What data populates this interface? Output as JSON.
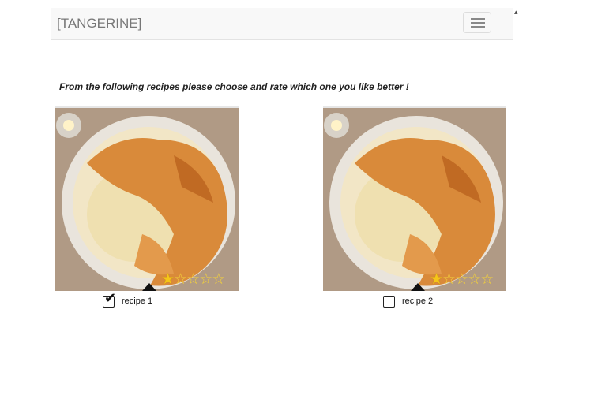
{
  "navbar": {
    "brand": "[TANGERINE]",
    "menu_icon": "hamburger-menu-icon"
  },
  "instruction": "From the following recipes please choose and rate which one you like better !",
  "recipes": [
    {
      "image_alt": "filo pastry pie",
      "rating": 1,
      "max_rating": 5,
      "checked": true,
      "label": "recipe 1"
    },
    {
      "image_alt": "filo pastry pie",
      "rating": 1,
      "max_rating": 5,
      "checked": false,
      "label": "recipe 2"
    }
  ],
  "colors": {
    "navbar_bg": "#f8f8f8",
    "brand_text": "#777777",
    "star_fill": "#f5c518"
  }
}
